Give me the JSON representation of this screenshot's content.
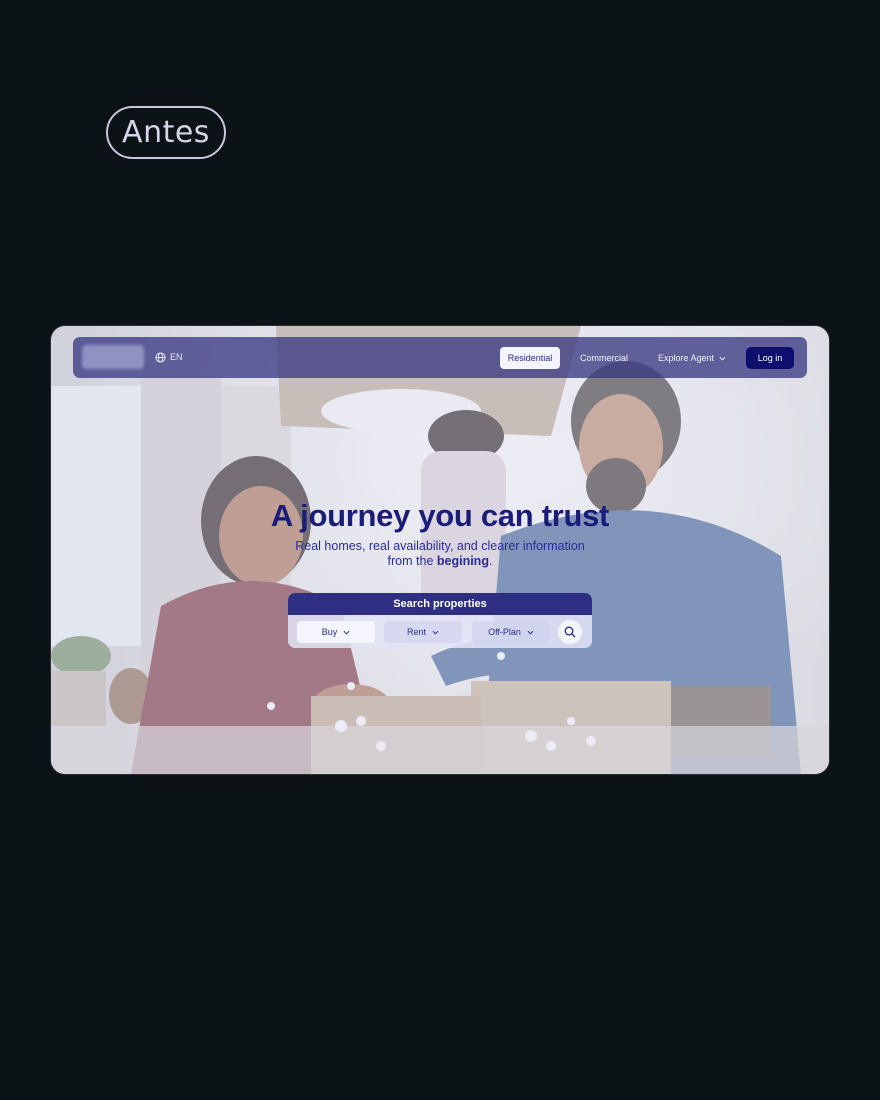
{
  "badge": {
    "label": "Antes"
  },
  "nav": {
    "lang": "EN",
    "items": [
      {
        "label": "Residential",
        "active": true
      },
      {
        "label": "Commercial"
      },
      {
        "label": "Explore Agent"
      }
    ],
    "login": "Log in"
  },
  "hero": {
    "title": "A journey you can trust",
    "subtitle_line1": "Real homes, real availability, and clearer information",
    "subtitle_line2_pre": "from the ",
    "subtitle_line2_bold": "begining",
    "subtitle_line2_post": "."
  },
  "search": {
    "title": "Search properties",
    "options": [
      {
        "label": "Buy",
        "active": true
      },
      {
        "label": "Rent"
      },
      {
        "label": "Off-Plan"
      }
    ]
  },
  "icons": {
    "lang": "globe-icon",
    "dropdown": "chevron-down-icon",
    "search": "search-icon"
  },
  "colors": {
    "background": "#0c1316",
    "navbar": "#3a3a82",
    "primary_dark": "#0d0f6e",
    "headline": "#1b1c78",
    "search_header": "#2e2f83"
  }
}
